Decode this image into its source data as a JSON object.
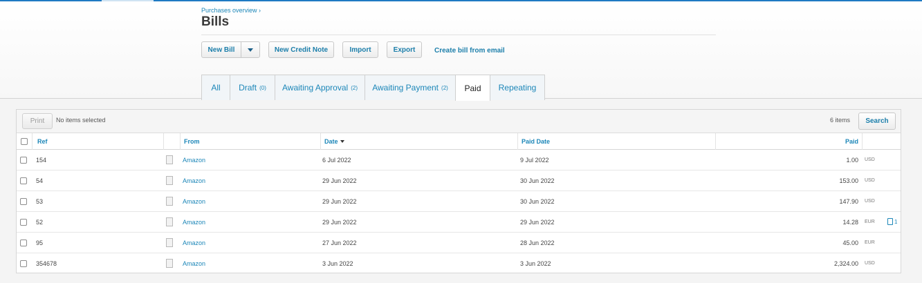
{
  "breadcrumb": "Purchases overview ›",
  "title": "Bills",
  "toolbar": {
    "new_bill": "New Bill",
    "new_credit_note": "New Credit Note",
    "import": "Import",
    "export": "Export",
    "create_from_email": "Create bill from email"
  },
  "tabs": [
    {
      "label": "All",
      "count": ""
    },
    {
      "label": "Draft",
      "count": "(0)"
    },
    {
      "label": "Awaiting Approval",
      "count": "(2)"
    },
    {
      "label": "Awaiting Payment",
      "count": "(2)"
    },
    {
      "label": "Paid",
      "count": ""
    },
    {
      "label": "Repeating",
      "count": ""
    }
  ],
  "active_tab": "Paid",
  "list": {
    "print": "Print",
    "selection": "No items selected",
    "count": "6 items",
    "search": "Search"
  },
  "columns": {
    "ref": "Ref",
    "from": "From",
    "date": "Date",
    "paid_date": "Paid Date",
    "paid": "Paid"
  },
  "rows": [
    {
      "ref": "154",
      "from": "Amazon",
      "date": "6 Jul 2022",
      "paid_date": "9 Jul 2022",
      "paid": "1.00",
      "currency": "USD",
      "attachments": ""
    },
    {
      "ref": "54",
      "from": "Amazon",
      "date": "29 Jun 2022",
      "paid_date": "30 Jun 2022",
      "paid": "153.00",
      "currency": "USD",
      "attachments": ""
    },
    {
      "ref": "53",
      "from": "Amazon",
      "date": "29 Jun 2022",
      "paid_date": "30 Jun 2022",
      "paid": "147.90",
      "currency": "USD",
      "attachments": ""
    },
    {
      "ref": "52",
      "from": "Amazon",
      "date": "29 Jun 2022",
      "paid_date": "29 Jun 2022",
      "paid": "14.28",
      "currency": "EUR",
      "attachments": "1"
    },
    {
      "ref": "95",
      "from": "Amazon",
      "date": "27 Jun 2022",
      "paid_date": "28 Jun 2022",
      "paid": "45.00",
      "currency": "EUR",
      "attachments": ""
    },
    {
      "ref": "354678",
      "from": "Amazon",
      "date": "3 Jun 2022",
      "paid_date": "3 Jun 2022",
      "paid": "2,324.00",
      "currency": "USD",
      "attachments": ""
    }
  ]
}
